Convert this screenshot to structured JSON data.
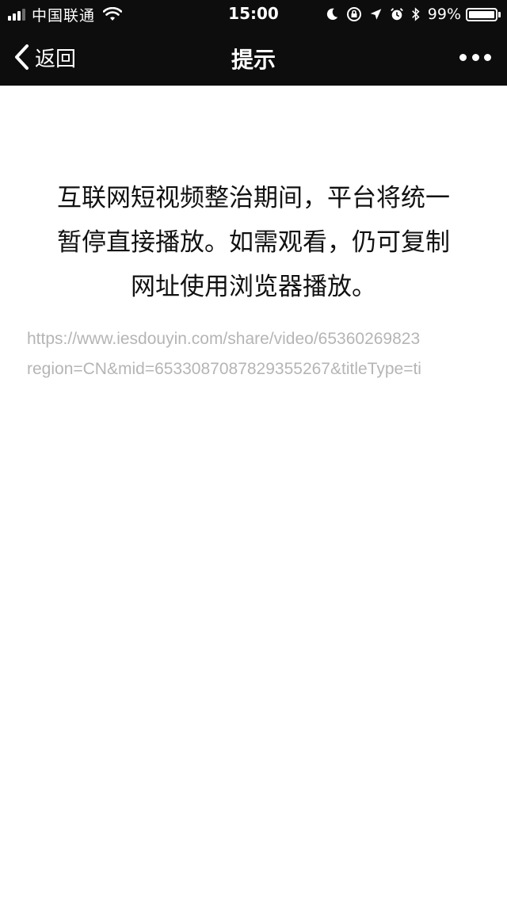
{
  "status_bar": {
    "carrier": "中国联通",
    "time": "15:00",
    "battery_percent": "99%",
    "icons": [
      "signal-icon",
      "wifi-icon",
      "moon-icon",
      "orientation-lock-icon",
      "location-arrow-icon",
      "alarm-icon",
      "bluetooth-icon",
      "battery-icon"
    ]
  },
  "nav": {
    "back_label": "返回",
    "title": "提示",
    "more_icon": "more-dots-icon"
  },
  "content": {
    "message_line_1": "互联网短视频整治期间，平台将统一",
    "message_line_2": "暂停直接播放。如需观看，仍可复制",
    "message_line_3": "网址使用浏览器播放。",
    "url_line_1": "https://www.iesdouyin.com/share/video/65360269823",
    "url_line_2": "region=CN&mid=6533087087829355267&titleType=ti"
  },
  "colors": {
    "header_bg": "#0d0d0d",
    "header_text": "#ffffff",
    "body_bg": "#ffffff",
    "message_text": "#111111",
    "url_text": "#b5b5b5"
  }
}
